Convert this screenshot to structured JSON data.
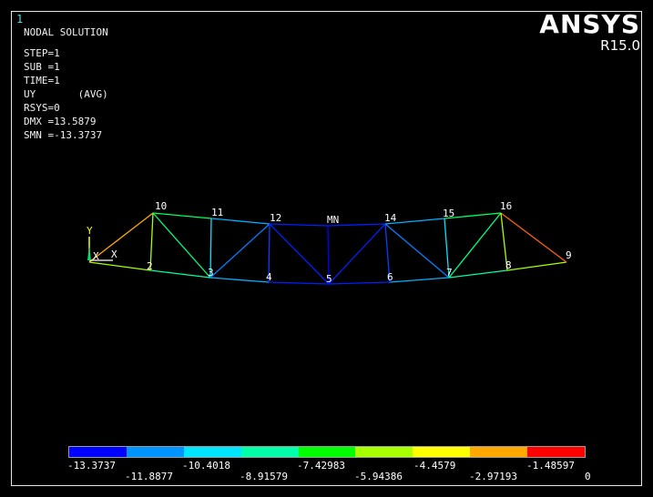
{
  "window_number": "1",
  "info_lines": [
    "NODAL SOLUTION",
    "",
    "STEP=1",
    "SUB =1",
    "TIME=1",
    "UY       (AVG)",
    "RSYS=0",
    "DMX =13.5879",
    "SMN =-13.3737"
  ],
  "brand": "ANSYS",
  "version": "R15.0",
  "triad": {
    "y_label": "Y",
    "x_label": "X",
    "origin_label": "X"
  },
  "node_labels": [
    "2",
    "3",
    "4",
    "5",
    "6",
    "7",
    "8",
    "9",
    "10",
    "11",
    "12",
    "MN",
    "14",
    "15",
    "16"
  ],
  "legend": {
    "colors": [
      "#0000ff",
      "#0094ff",
      "#00e4ff",
      "#00ffa8",
      "#00ff00",
      "#a8ff00",
      "#ffff00",
      "#ffa800",
      "#ff0000"
    ],
    "values_top": [
      "-13.3737",
      "-10.4018",
      "-7.42983",
      "-4.4579",
      "-1.48597"
    ],
    "values_bottom": [
      "-11.8877",
      "-8.91579",
      "-5.94386",
      "-2.97193",
      "0"
    ]
  }
}
